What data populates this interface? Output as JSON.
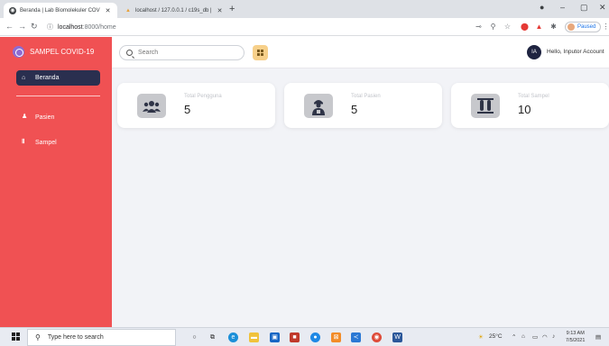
{
  "browser": {
    "tabs": [
      {
        "title": "Beranda | Lab Biomolekuler COV"
      },
      {
        "title": "localhost / 127.0.0.1 / c19s_db | "
      }
    ],
    "new_tab_label": "+",
    "url_host": "localhost",
    "url_path": ":8000/home",
    "paused_label": "Paused"
  },
  "sidebar": {
    "brand": "SAMPEL COVID-19",
    "active_item": "Beranda",
    "items": [
      {
        "label": "Pasien"
      },
      {
        "label": "Sampel"
      }
    ]
  },
  "topbar": {
    "search_placeholder": "Search",
    "avatar_initials": "IA",
    "greeting": "Hello, Inputor Account"
  },
  "cards": [
    {
      "label": "Total Pengguna",
      "value": "5",
      "icon": "users-icon"
    },
    {
      "label": "Total Pasien",
      "value": "5",
      "icon": "patient-icon"
    },
    {
      "label": "Total Sampel",
      "value": "10",
      "icon": "test-tubes-icon"
    }
  ],
  "taskbar": {
    "search_placeholder": "Type here to search",
    "temperature": "25°C",
    "time": "9:13 AM",
    "date": "7/5/2021"
  },
  "colors": {
    "sidebar": "#f05153",
    "active_nav": "#2a2f4f",
    "accent_button": "#f7d08a"
  }
}
